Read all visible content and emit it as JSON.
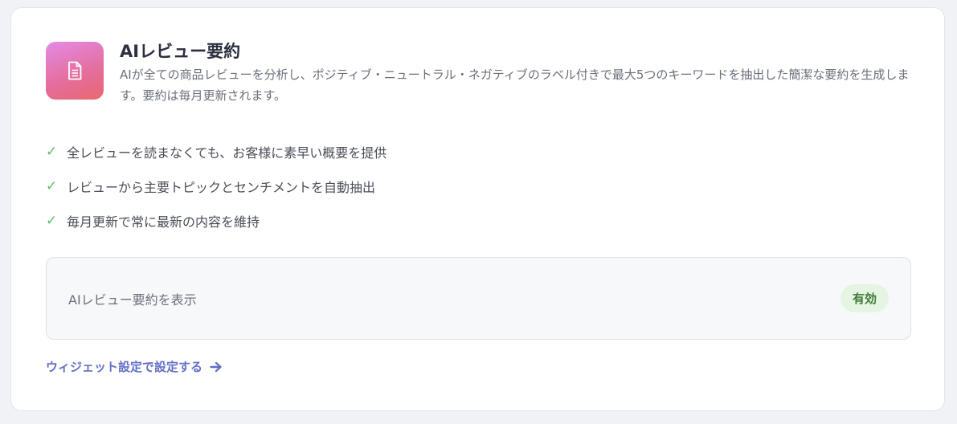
{
  "header": {
    "icon": "document-icon",
    "title": "AIレビュー要約",
    "description": "AIが全ての商品レビューを分析し、ポジティブ・ニュートラル・ネガティブのラベル付きで最大5つのキーワードを抽出した簡潔な要約を生成します。要約は毎月更新されます。"
  },
  "features": [
    {
      "icon": "check-icon",
      "text": "全レビューを読まなくても、お客様に素早い概要を提供"
    },
    {
      "icon": "check-icon",
      "text": "レビューから主要トピックとセンチメントを自動抽出"
    },
    {
      "icon": "check-icon",
      "text": "毎月更新で常に最新の内容を維持"
    }
  ],
  "setting": {
    "label": "AIレビュー要約を表示",
    "status": "有効"
  },
  "link": {
    "label": "ウィジェット設定で設定する",
    "icon": "arrow-right-icon"
  },
  "colors": {
    "check": "#5cbf63",
    "badge_bg": "#e5f4e3",
    "badge_text": "#3d7a34",
    "link": "#6270c7",
    "icon_gradient_start": "#e58ae6",
    "icon_gradient_end": "#e9686e"
  }
}
